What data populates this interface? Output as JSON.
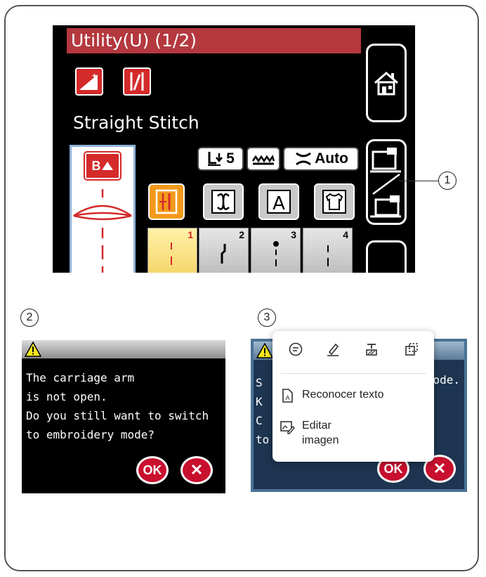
{
  "screen": {
    "title": "Utility(U) (1/2)",
    "stitch_name": "Straight Stitch",
    "preview_badge": "B",
    "settings": {
      "presser_foot_value": "5",
      "tension_value": "Auto"
    },
    "stitch_tiles": [
      "1",
      "2",
      "3",
      "4"
    ],
    "categories": [
      "utility-stitch",
      "decorative-stitch",
      "letters",
      "garment"
    ]
  },
  "callouts": {
    "c1": "1",
    "c2": "2",
    "c3": "3"
  },
  "dialog2": {
    "lines": [
      "The carriage arm",
      "is not open.",
      "Do you still want to switch",
      "to embroidery mode?"
    ],
    "ok_label": "OK",
    "cancel_label": "✕"
  },
  "dialog3": {
    "left_fragments": [
      "S",
      "K",
      "C",
      "to"
    ],
    "right_fragment": "ode.",
    "ok_label": "OK",
    "cancel_label": "✕"
  },
  "popup": {
    "items": [
      {
        "label": "Reconocer texto"
      },
      {
        "label_line1": "Editar",
        "label_line2": "imagen"
      }
    ]
  },
  "colors": {
    "title_red": "#b5383f",
    "accent_orange": "#f39a1b",
    "button_red": "#c8102e"
  }
}
